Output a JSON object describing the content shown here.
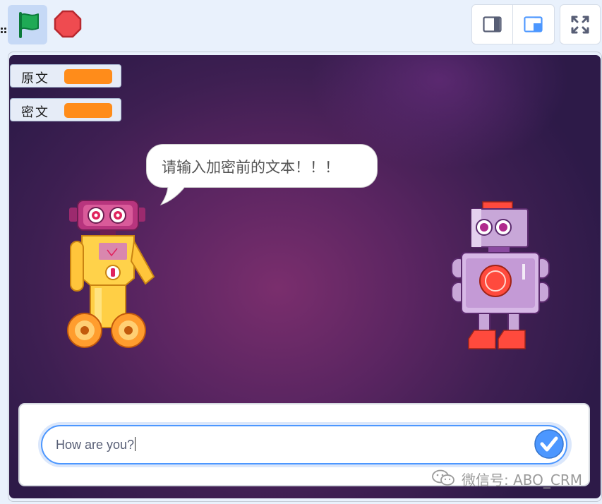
{
  "toolbar": {
    "green_flag_icon": "green-flag-icon",
    "stop_icon": "stop-sign-icon",
    "layout_small_icon": "small-stage-icon",
    "layout_normal_icon": "normal-stage-icon",
    "fullscreen_icon": "fullscreen-icon"
  },
  "monitors": [
    {
      "label": "原文",
      "value": ""
    },
    {
      "label": "密文",
      "value": ""
    }
  ],
  "stage": {
    "speech_bubble": "请输入加密前的文本！！！"
  },
  "ask_prompt": {
    "input_value": "How are you?",
    "submit_icon": "checkmark-icon"
  },
  "watermark": {
    "text": "微信号: ABO_CRM",
    "icon": "wechat-icon"
  },
  "colors": {
    "monitor_value": "#ff8c1a",
    "flag": "#0ea14d",
    "stop": "#ef4b50",
    "accent": "#4c97ff"
  }
}
